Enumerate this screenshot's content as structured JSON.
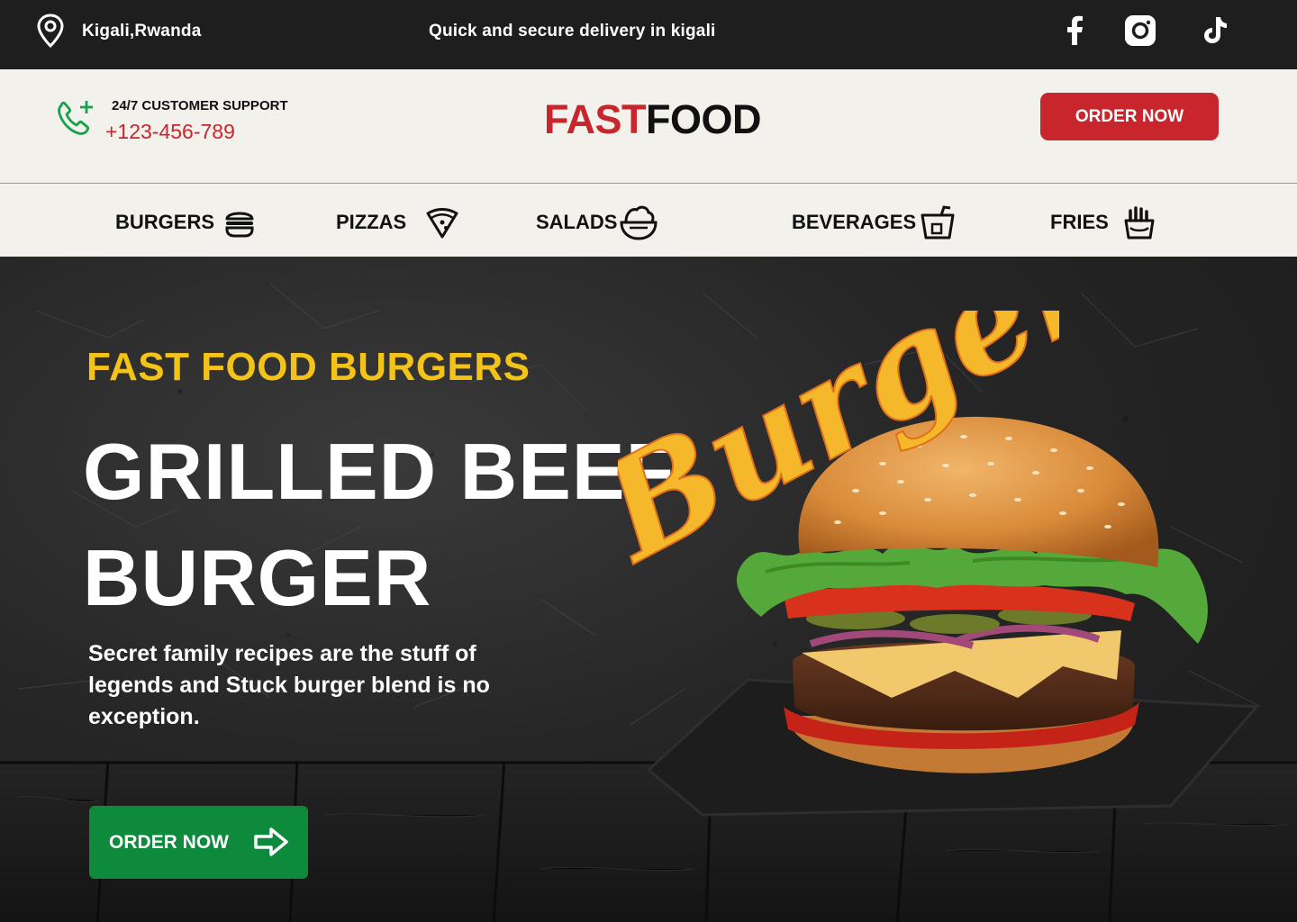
{
  "topbar": {
    "location": "Kigali,Rwanda",
    "tagline": "Quick and secure delivery in kigali",
    "social": [
      "facebook-icon",
      "instagram-icon",
      "tiktok-icon"
    ]
  },
  "header": {
    "support_label": "24/7 CUSTOMER SUPPORT",
    "phone": "+123-456-789",
    "logo_part1": "FAST",
    "logo_part2": "FOOD",
    "order_button": "ORDER NOW"
  },
  "nav": {
    "items": [
      {
        "label": "BURGERS",
        "icon": "burger-icon"
      },
      {
        "label": "PIZZAS",
        "icon": "pizza-icon"
      },
      {
        "label": "SALADS",
        "icon": "salad-bowl-icon"
      },
      {
        "label": "BEVERAGES",
        "icon": "beverage-icon"
      },
      {
        "label": "FRIES",
        "icon": "fries-icon"
      }
    ]
  },
  "hero": {
    "kicker": "FAST FOOD BURGERS",
    "title_line1": "GRILLED BEEF",
    "title_line2": "BURGER",
    "description": "Secret family recipes are the stuff of legends and Stuck burger blend is no exception.",
    "cta": "ORDER NOW",
    "script_word": "Burgers"
  },
  "colors": {
    "brand_red": "#c8262c",
    "accent_yellow": "#f3c319",
    "cta_green": "#0e8a3c",
    "topbar_bg": "#1e1e1e",
    "header_bg": "#f3f1ec"
  }
}
